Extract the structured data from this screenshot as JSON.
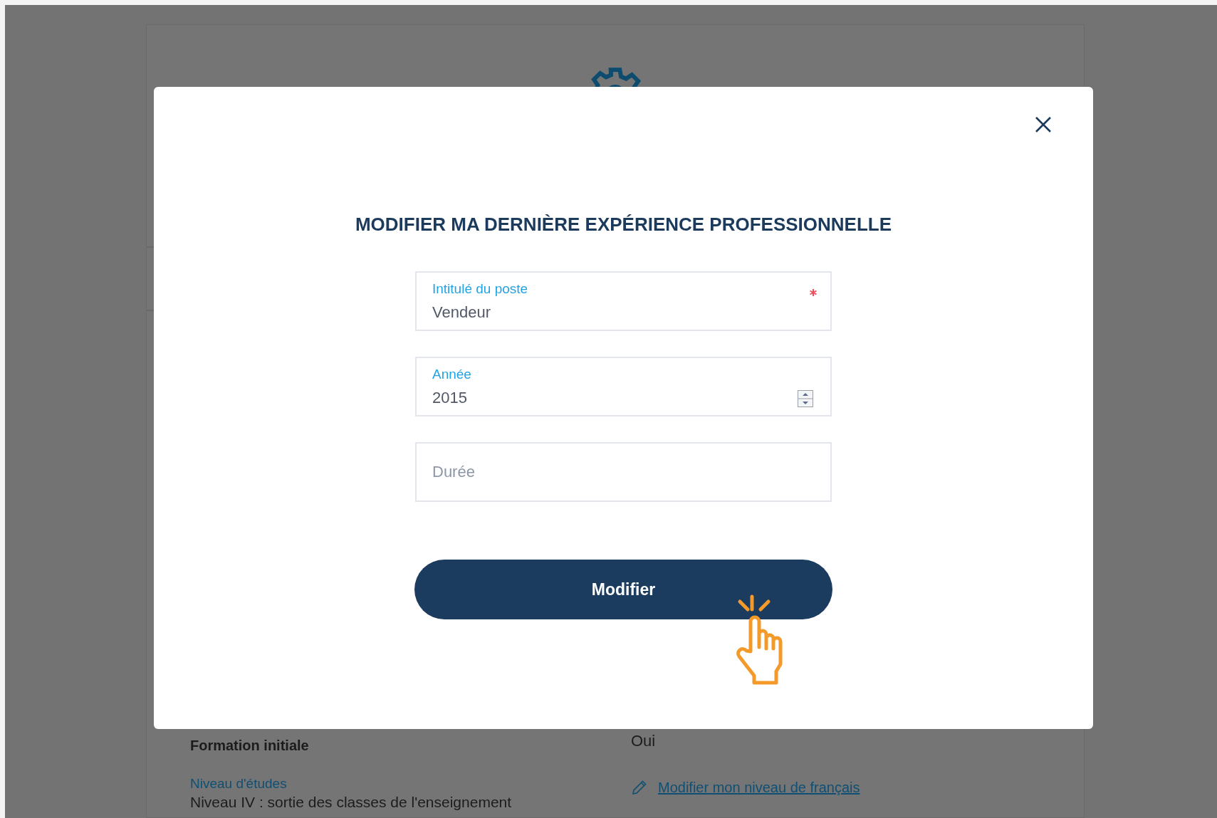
{
  "background_page": {
    "left_heading": "Formation initiale",
    "right_value": "Oui",
    "study_level": {
      "label": "Niveau d'études",
      "value": "Niveau IV : sortie des classes de l'enseignement"
    },
    "french_level_link": "Modifier mon niveau de français"
  },
  "modal": {
    "title": "MODIFIER MA DERNIÈRE EXPÉRIENCE PROFESSIONNELLE",
    "fields": [
      {
        "kind": "text",
        "label": "Intitulé du poste",
        "value": "Vendeur",
        "required": true
      },
      {
        "kind": "number",
        "label": "Année",
        "value": "2015",
        "required": false
      },
      {
        "kind": "empty",
        "placeholder": "Durée"
      }
    ],
    "submit_button": "Modifier"
  }
}
